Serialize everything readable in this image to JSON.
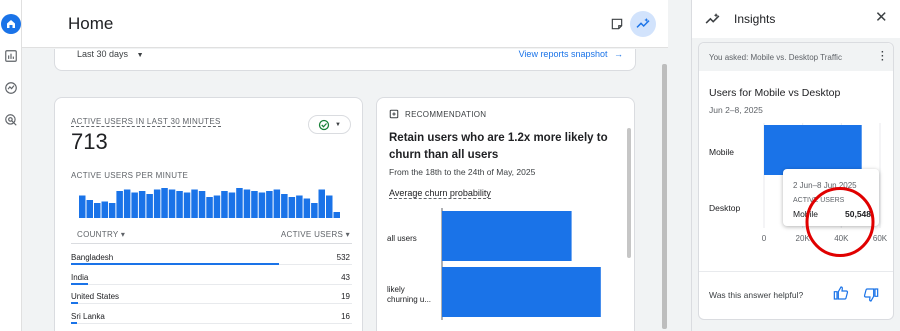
{
  "nav": {
    "icons": [
      "home-icon",
      "bar-chart-icon",
      "explore-icon",
      "advertising-icon"
    ]
  },
  "header": {
    "title": "Home"
  },
  "snapshot": {
    "date_range": "Last 30 days",
    "link": "View reports snapshot"
  },
  "realtime": {
    "heading": "ACTIVE USERS IN LAST 30 MINUTES",
    "value": "713",
    "subheading": "ACTIVE USERS PER MINUTE",
    "bars": [
      0.75,
      0.6,
      0.5,
      0.55,
      0.5,
      0.9,
      0.95,
      0.85,
      0.9,
      0.8,
      0.95,
      1.0,
      0.95,
      0.9,
      0.85,
      0.95,
      0.9,
      0.7,
      0.75,
      0.9,
      0.85,
      1.0,
      0.95,
      0.9,
      0.85,
      0.9,
      0.95,
      0.8,
      0.7,
      0.75,
      0.65,
      0.5,
      0.95,
      0.75,
      0.2
    ],
    "col_country": "COUNTRY",
    "col_active": "ACTIVE USERS",
    "rows": [
      {
        "country": "Bangladesh",
        "users": "532",
        "frac": 1.0
      },
      {
        "country": "India",
        "users": "43",
        "frac": 0.08
      },
      {
        "country": "United States",
        "users": "19",
        "frac": 0.036
      },
      {
        "country": "Sri Lanka",
        "users": "16",
        "frac": 0.03
      }
    ]
  },
  "recommendation": {
    "label": "RECOMMENDATION",
    "title": "Retain users who are 1.2x more likely to churn than all users",
    "subtitle": "From the 18th to the 24th of May, 2025",
    "chart_label": "Average churn probability"
  },
  "insights": {
    "title": "Insights",
    "asked": "You asked: Mobile vs. Desktop Traffic",
    "chart_title": "Users for Mobile vs Desktop",
    "date": "Jun 2–8, 2025",
    "tooltip": {
      "date": "2 Jun–8 Jun 2025",
      "label": "ACTIVE USERS",
      "device": "Mobile",
      "value": "50,548"
    },
    "helpful": "Was this answer helpful?"
  },
  "chart_data": [
    {
      "type": "bar",
      "orientation": "horizontal",
      "title": "Average churn probability",
      "categories": [
        "all users",
        "likely churning u..."
      ],
      "values": [
        0.8,
        0.98
      ],
      "xlim": [
        0,
        1
      ],
      "xticks": [
        "0",
        "0.2",
        "0.4",
        "0.6",
        "0.8",
        "1"
      ],
      "color": "#1a73e8"
    },
    {
      "type": "bar",
      "orientation": "horizontal",
      "title": "Users for Mobile vs Desktop",
      "categories": [
        "Mobile",
        "Desktop"
      ],
      "values": [
        50548,
        0
      ],
      "xlim": [
        0,
        60000
      ],
      "xticks": [
        "0",
        "20K",
        "40K",
        "60K"
      ],
      "color": "#1a73e8"
    }
  ]
}
